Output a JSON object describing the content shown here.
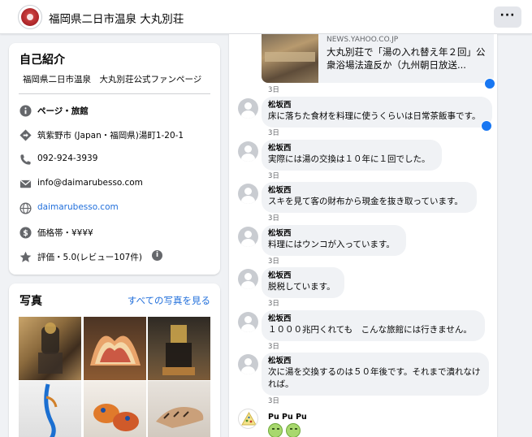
{
  "header": {
    "page_name": "福岡県二日市温泉 大丸別荘",
    "more_label": "···"
  },
  "about": {
    "title": "自己紹介",
    "description": "福岡県二日市温泉　大丸別荘公式ファンページ",
    "items": [
      {
        "icon": "info-icon",
        "text": "ページ・旅館"
      },
      {
        "icon": "location-pin-icon",
        "text": "筑紫野市 (Japan・福岡県)湯町1-20-1"
      },
      {
        "icon": "phone-icon",
        "text": "092-924-3939"
      },
      {
        "icon": "mail-icon",
        "text": "info@daimarubesso.com"
      },
      {
        "icon": "globe-icon",
        "text": "daimarubesso.com"
      },
      {
        "icon": "price-icon",
        "text": "価格帯・¥¥¥¥"
      },
      {
        "icon": "star-icon",
        "text": "評価・5.0(レビュー107件)",
        "badge": "i"
      }
    ]
  },
  "photos": {
    "title": "写真",
    "see_all": "すべての写真を見る"
  },
  "link_preview": {
    "domain": "NEWS.YAHOO.CO.JP",
    "title": "大丸別荘で「湯の入れ替え年２回」公衆浴場法違反か（九州朝日放送..."
  },
  "link_meta": "3日",
  "comments": [
    {
      "author": "松坂西",
      "text": "床に落ちた食材を料理に使うくらいは日常茶飯事です。",
      "time": "3日"
    },
    {
      "author": "松坂西",
      "text": "実際には湯の交換は１０年に１回でした。",
      "time": "3日"
    },
    {
      "author": "松坂西",
      "text": "スキを見て客の財布から現金を抜き取っています。",
      "time": "3日"
    },
    {
      "author": "松坂西",
      "text": "料理にはウンコが入っています。",
      "time": "3日"
    },
    {
      "author": "松坂西",
      "text": "脱税しています。",
      "time": "3日"
    },
    {
      "author": "松坂西",
      "text": "１０００兆円くれても　こんな旅館には行きません。",
      "time": "3日"
    },
    {
      "author": "松坂西",
      "text": "次に湯を交換するのは５０年後です。それまで潰れなければ。",
      "time": "3日"
    }
  ],
  "last_comment": {
    "author": "Pu Pu Pu"
  },
  "colors": {
    "link_blue": "#216fdb",
    "like_blue": "#1877f2",
    "bubble_bg": "#f0f2f5"
  }
}
